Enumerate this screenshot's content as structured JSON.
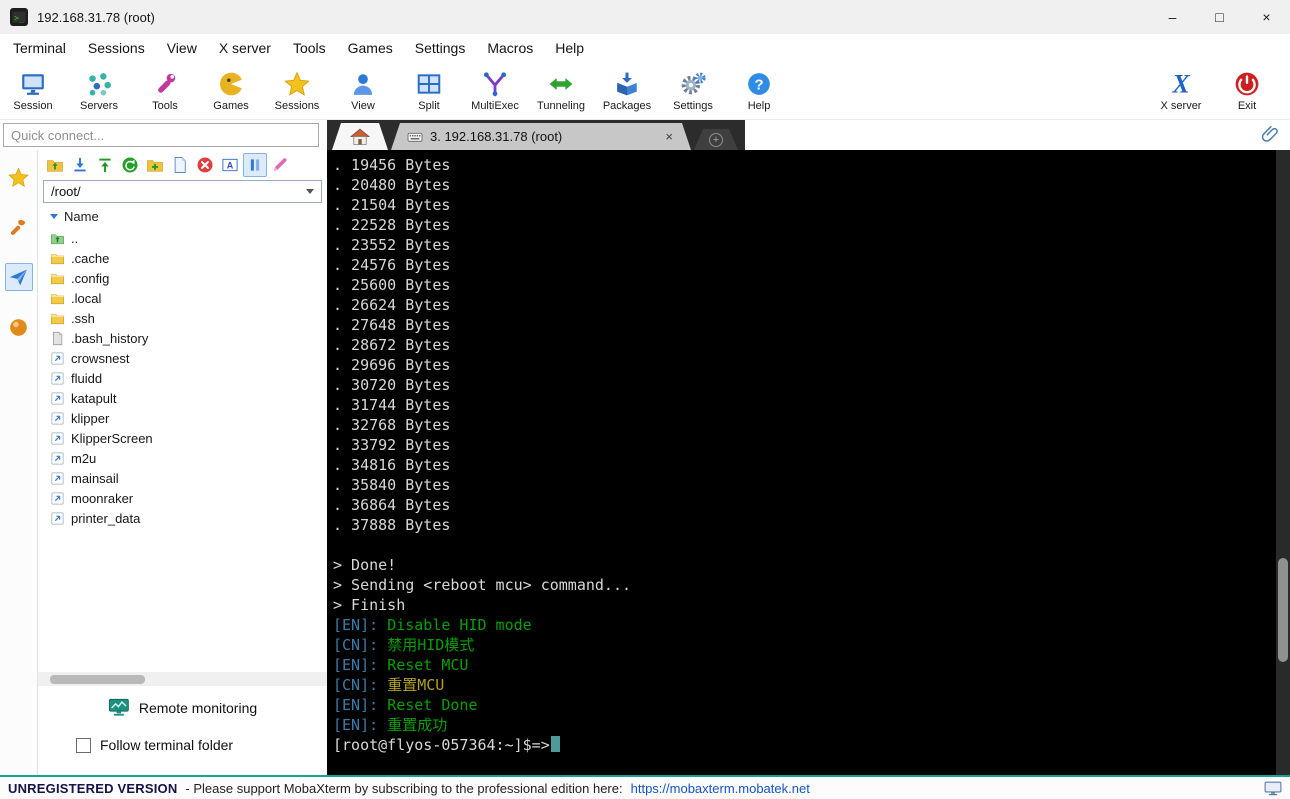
{
  "window": {
    "title": "192.168.31.78 (root)",
    "controls": {
      "minimize": "–",
      "maximize": "□",
      "close": "×"
    }
  },
  "menu_items": [
    "Terminal",
    "Sessions",
    "View",
    "X server",
    "Tools",
    "Games",
    "Settings",
    "Macros",
    "Help"
  ],
  "toolbar": {
    "items": [
      {
        "label": "Session",
        "icon": "session-monitor-icon"
      },
      {
        "label": "Servers",
        "icon": "servers-icon"
      },
      {
        "label": "Tools",
        "icon": "tools-icon"
      },
      {
        "label": "Games",
        "icon": "games-icon"
      },
      {
        "label": "Sessions",
        "icon": "sessions-star-icon"
      },
      {
        "label": "View",
        "icon": "view-user-icon"
      },
      {
        "label": "Split",
        "icon": "split-icon"
      },
      {
        "label": "MultiExec",
        "icon": "multiexec-icon"
      },
      {
        "label": "Tunneling",
        "icon": "tunneling-icon"
      },
      {
        "label": "Packages",
        "icon": "packages-icon"
      },
      {
        "label": "Settings",
        "icon": "settings-gear-icon"
      },
      {
        "label": "Help",
        "icon": "help-icon"
      }
    ],
    "right_items": [
      {
        "label": "X server",
        "icon": "xserver-icon"
      },
      {
        "label": "Exit",
        "icon": "exit-power-icon"
      }
    ]
  },
  "quick_connect_placeholder": "Quick connect...",
  "tab_bar": {
    "active_tab_label": "3. 192.168.31.78 (root)",
    "close_glyph": "×",
    "new_tab_glyph": "+"
  },
  "side_strip": [
    {
      "name": "sidebar-sessions-button",
      "icon": "star-icon",
      "selected": false
    },
    {
      "name": "sidebar-tools-button",
      "icon": "side-tools-icon",
      "selected": false
    },
    {
      "name": "sidebar-sftp-button",
      "icon": "sftp-plane-icon",
      "selected": true
    },
    {
      "name": "sidebar-macros-button",
      "icon": "macros-ball-icon",
      "selected": false
    }
  ],
  "sftp": {
    "toolbar": [
      {
        "name": "sftp-parent-dir-button",
        "icon": "parent-folder-icon",
        "selected": false
      },
      {
        "name": "sftp-download-button",
        "icon": "download-icon",
        "selected": false
      },
      {
        "name": "sftp-upload-button",
        "icon": "upload-icon",
        "selected": false
      },
      {
        "name": "sftp-refresh-button",
        "icon": "refresh-icon",
        "selected": false
      },
      {
        "name": "sftp-new-folder-button",
        "icon": "new-folder-icon",
        "selected": false
      },
      {
        "name": "sftp-new-file-button",
        "icon": "new-file-icon",
        "selected": false
      },
      {
        "name": "sftp-delete-button",
        "icon": "delete-icon",
        "selected": false
      },
      {
        "name": "sftp-rename-button",
        "icon": "rename-icon",
        "selected": false
      },
      {
        "name": "sftp-sync-button",
        "icon": "sync-icon",
        "selected": true
      },
      {
        "name": "sftp-edit-button",
        "icon": "edit-icon",
        "selected": false
      }
    ],
    "path": "/root/",
    "name_header": "Name",
    "items": [
      {
        "name": "..",
        "type": "up"
      },
      {
        "name": ".cache",
        "type": "folder"
      },
      {
        "name": ".config",
        "type": "folder"
      },
      {
        "name": ".local",
        "type": "folder"
      },
      {
        "name": ".ssh",
        "type": "folder"
      },
      {
        "name": ".bash_history",
        "type": "file"
      },
      {
        "name": "crowsnest",
        "type": "link"
      },
      {
        "name": "fluidd",
        "type": "link"
      },
      {
        "name": "katapult",
        "type": "link"
      },
      {
        "name": "klipper",
        "type": "link"
      },
      {
        "name": "KlipperScreen",
        "type": "link"
      },
      {
        "name": "m2u",
        "type": "link"
      },
      {
        "name": "mainsail",
        "type": "link"
      },
      {
        "name": "moonraker",
        "type": "link"
      },
      {
        "name": "printer_data",
        "type": "link"
      }
    ],
    "remote_monitoring_label": "Remote monitoring",
    "follow_terminal_folder_label": "Follow terminal folder"
  },
  "terminal": {
    "colors": {
      "fg": "#d8d8d8",
      "grn": "#00a000",
      "yel": "#b1a11b",
      "lbl": "#3a7ca8",
      "bg": "#000000",
      "cursor": "#4d9a9a"
    },
    "lines": [
      [
        {
          "t": ". 19456 Bytes",
          "c": "fg"
        }
      ],
      [
        {
          "t": ". 20480 Bytes",
          "c": "fg"
        }
      ],
      [
        {
          "t": ". 21504 Bytes",
          "c": "fg"
        }
      ],
      [
        {
          "t": ". 22528 Bytes",
          "c": "fg"
        }
      ],
      [
        {
          "t": ". 23552 Bytes",
          "c": "fg"
        }
      ],
      [
        {
          "t": ". 24576 Bytes",
          "c": "fg"
        }
      ],
      [
        {
          "t": ". 25600 Bytes",
          "c": "fg"
        }
      ],
      [
        {
          "t": ". 26624 Bytes",
          "c": "fg"
        }
      ],
      [
        {
          "t": ". 27648 Bytes",
          "c": "fg"
        }
      ],
      [
        {
          "t": ". 28672 Bytes",
          "c": "fg"
        }
      ],
      [
        {
          "t": ". 29696 Bytes",
          "c": "fg"
        }
      ],
      [
        {
          "t": ". 30720 Bytes",
          "c": "fg"
        }
      ],
      [
        {
          "t": ". 31744 Bytes",
          "c": "fg"
        }
      ],
      [
        {
          "t": ". 32768 Bytes",
          "c": "fg"
        }
      ],
      [
        {
          "t": ". 33792 Bytes",
          "c": "fg"
        }
      ],
      [
        {
          "t": ". 34816 Bytes",
          "c": "fg"
        }
      ],
      [
        {
          "t": ". 35840 Bytes",
          "c": "fg"
        }
      ],
      [
        {
          "t": ". 36864 Bytes",
          "c": "fg"
        }
      ],
      [
        {
          "t": ". 37888 Bytes",
          "c": "fg"
        }
      ],
      [],
      [
        {
          "t": "> Done!",
          "c": "fg"
        }
      ],
      [
        {
          "t": "> Sending <reboot mcu> command...",
          "c": "fg"
        }
      ],
      [
        {
          "t": "> Finish",
          "c": "fg"
        }
      ],
      [
        {
          "t": "[EN]: ",
          "c": "lbl"
        },
        {
          "t": "Disable HID mode",
          "c": "grn"
        }
      ],
      [
        {
          "t": "[CN]: ",
          "c": "lbl"
        },
        {
          "t": "禁用HID模式",
          "c": "grn"
        }
      ],
      [
        {
          "t": "[EN]: ",
          "c": "lbl"
        },
        {
          "t": "Reset MCU",
          "c": "grn"
        }
      ],
      [
        {
          "t": "[CN]: ",
          "c": "lbl"
        },
        {
          "t": "重置MCU",
          "c": "yel"
        }
      ],
      [
        {
          "t": "[EN]: ",
          "c": "lbl"
        },
        {
          "t": "Reset Done",
          "c": "grn"
        }
      ],
      [
        {
          "t": "[EN]: ",
          "c": "lbl"
        },
        {
          "t": "重置成功",
          "c": "grn"
        }
      ],
      [
        {
          "t": "[root@flyos-057364:~]$=>",
          "c": "fg"
        }
      ]
    ]
  },
  "statusbar": {
    "version_label": "UNREGISTERED VERSION",
    "message": "-  Please support MobaXterm by subscribing to the professional edition here:",
    "link": "https://mobaxterm.mobatek.net"
  }
}
